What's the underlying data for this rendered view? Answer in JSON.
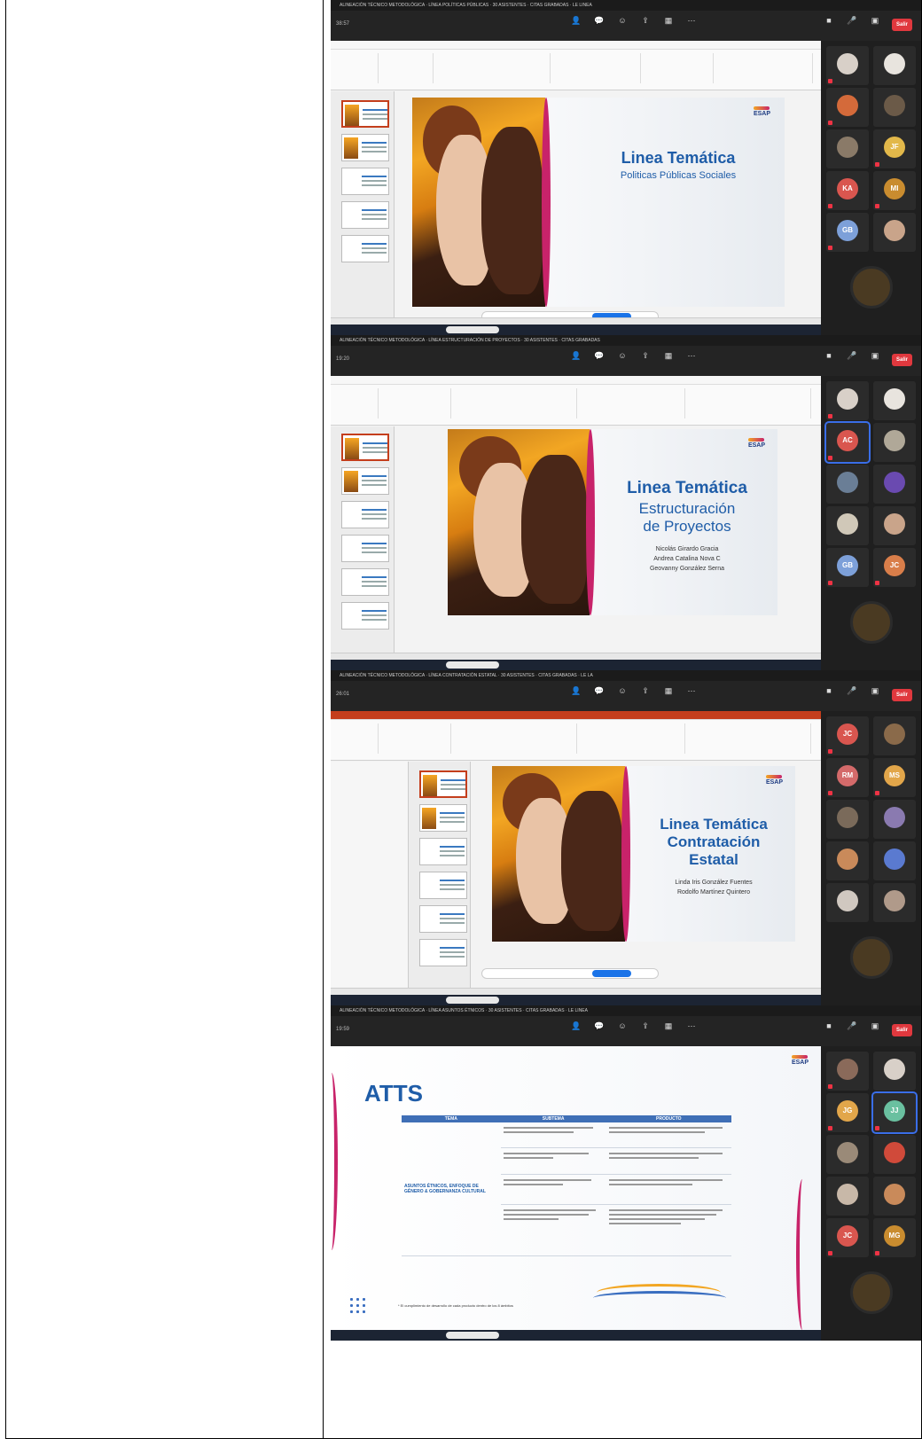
{
  "zoom": {
    "window_titles": [
      "ALINEACIÓN TÉCNICO METODOLÓGICA · LÍNEA POLÍTICAS PÚBLICAS · 30 ASISTENTES · CITAS GRABADAS · LE LINEA",
      "ALINEACIÓN TÉCNICO METODOLÓGICA · LÍNEA ESTRUCTURACIÓN DE PROYECTOS · 30 ASISTENTES · CITAS GRABADAS",
      "ALINEACIÓN TÉCNICO METODOLÓGICA · LÍNEA CONTRATACIÓN ESTATAL · 30 ASISTENTES · CITAS GRABADAS · LE LA",
      "ALINEACIÓN TÉCNICO METODOLÓGICA · LÍNEA ASUNTOS ÉTNICOS · 30 ASISTENTES · CITAS GRABADAS · LE LINEA"
    ],
    "timers": [
      "38:57",
      "19:20",
      "26:01",
      "19:59"
    ],
    "leave_label": "Salir"
  },
  "slides": [
    {
      "title": "Linea Temática",
      "subtitle": "Politicas Públicas Sociales"
    },
    {
      "title": "Linea Temática",
      "subtitle_lines": [
        "Estructuración",
        "de Proyectos"
      ],
      "names": [
        "Nicolás Girardo Gracia",
        "Andrea Catalina Nova C",
        "Geovanny González Serna"
      ]
    },
    {
      "title": "Linea Temática",
      "subtitle_lines": [
        "Contratación",
        "Estatal"
      ],
      "names": [
        "Linda Iris González Fuentes",
        "Rodolfo Martínez Quintero"
      ]
    },
    {
      "title": "ATTS",
      "table": {
        "headers": [
          "TEMA",
          "SUBTEMA",
          "PRODUCTO"
        ],
        "category": "ASUNTOS ÉTNICOS, ENFOQUE DE GÉNERO & GOBERNANZA CULTURAL",
        "footnote": "* El cumplimiento de desarrollo de cada producto dentro de los 8 ámbitos"
      }
    }
  ],
  "participants": {
    "shot1": [
      "",
      "",
      "",
      "",
      "",
      "JF",
      "KA",
      "MI",
      "GB",
      ""
    ],
    "shot2": [
      "",
      "",
      "AC",
      "",
      "",
      "",
      "",
      "",
      "GB",
      "JC"
    ],
    "shot3": [
      "JC",
      "",
      "RM",
      "MS",
      "",
      "",
      "",
      "",
      "",
      ""
    ],
    "shot4": [
      "",
      "",
      "JG",
      "JJ",
      "",
      "",
      "",
      "",
      "JC",
      "MG"
    ],
    "avatar_colors": [
      "#e9e1d6",
      "#f2efe9",
      "#e27d4a",
      "#9fb5d6",
      "#e2b84a",
      "#f0c89a",
      "#d9564f",
      "#c98c2f",
      "#7da0d9",
      "#d97e4a"
    ]
  }
}
